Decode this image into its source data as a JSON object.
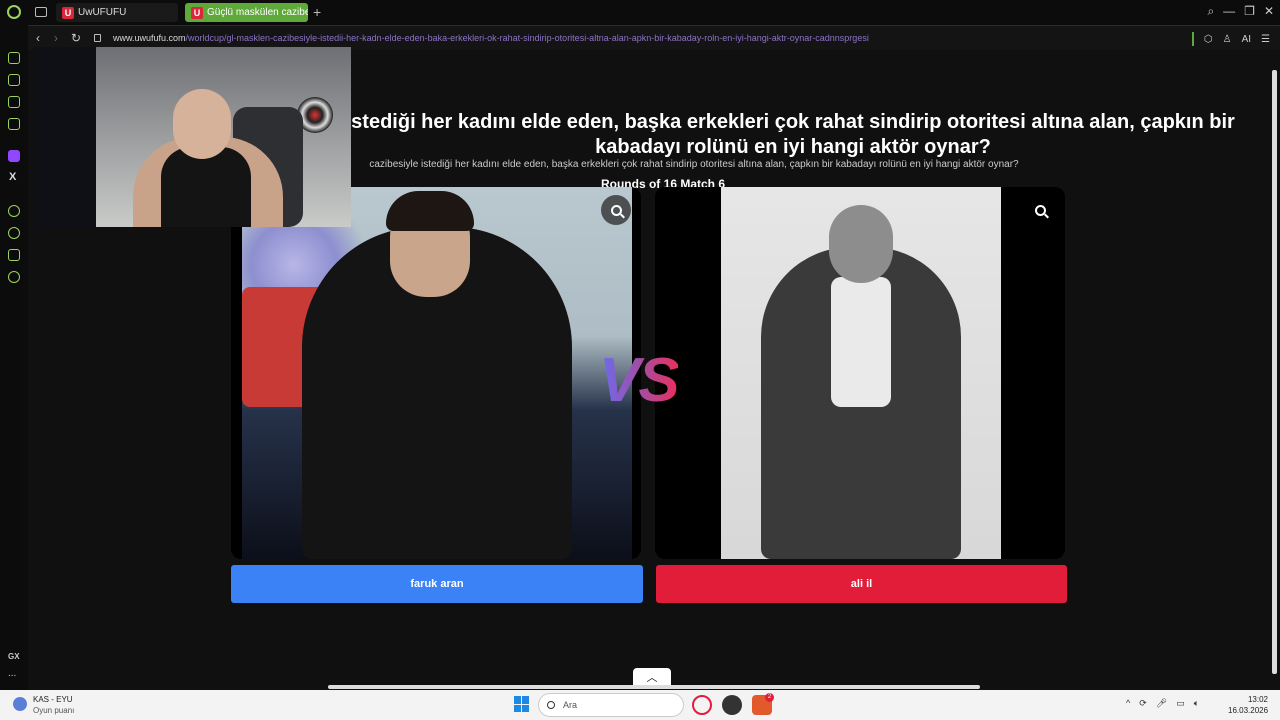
{
  "tabs": [
    {
      "label": "UwUFUFU",
      "favicon": "U"
    },
    {
      "label": "Güçlü maskülen cazibesiyle",
      "favicon": "U"
    }
  ],
  "address": {
    "host": "www.uwufufu.com",
    "path": "/worldcup/gl-masklen-cazibesiyle-istedii-her-kadn-elde-eden-baka-erkekleri-ok-rahat-sindirip-otoritesi-altna-alan-apkn-bir-kabaday-roln-en-iyi-hangi-aktr-oynar-cadnnsprgesi"
  },
  "addr_right": {
    "ai_label": "AI"
  },
  "sidebar": {
    "gx_label": "GX",
    "more_label": "..."
  },
  "page": {
    "title": "stediği her kadını elde eden, başka erkekleri çok rahat sindirip otoritesi altına alan, çapkın bir kabadayı rolünü en iyi hangi aktör oynar?",
    "subtitle": "cazibesiyle istediği her kadını elde eden, başka erkekleri çok rahat sindirip otoritesi altına alan, çapkın bir kabadayı rolünü en iyi hangi aktör oynar?",
    "rounds": "Rounds of 16 Match 6",
    "vs_label": "VS",
    "choice_left": "faruk aran",
    "choice_right": "ali il",
    "colors": {
      "left": "#3b82f6",
      "right": "#e11d3a"
    }
  },
  "taskbar": {
    "weather_title": "KAS - EYU",
    "weather_sub": "Oyun puanı",
    "search_placeholder": "Ara",
    "badge_count": "2",
    "time": "13:02",
    "date": "16.03.2026"
  }
}
